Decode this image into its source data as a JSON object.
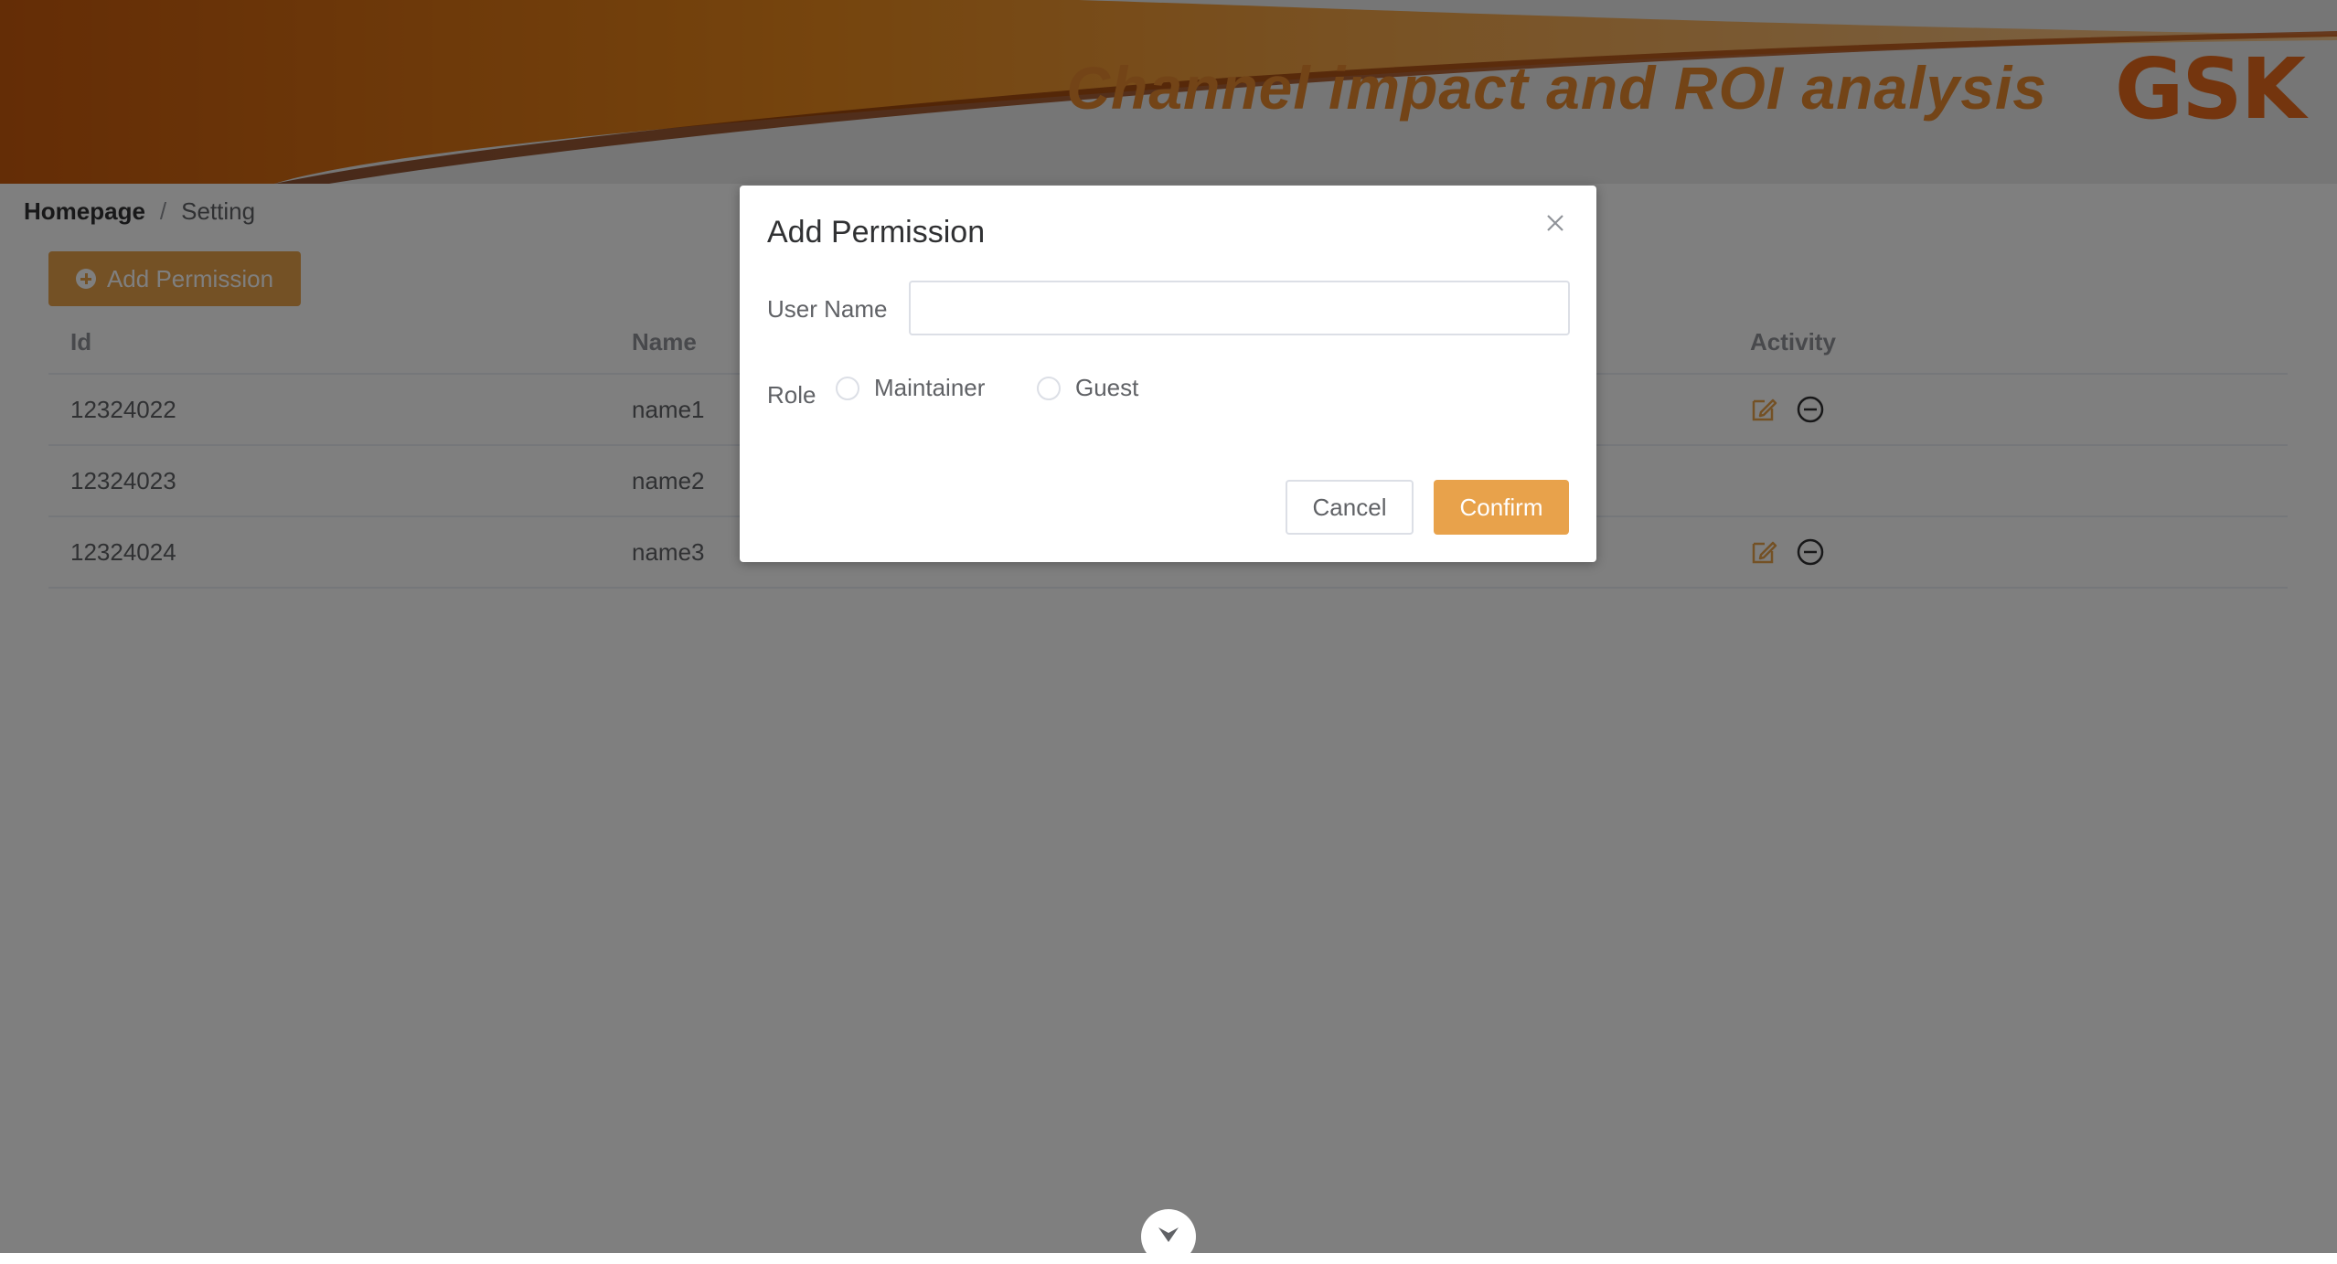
{
  "header": {
    "title": "Channel impact and ROI analysis",
    "logo": "GSK",
    "accent_color": "#e7892f",
    "logo_color": "#e96b1d"
  },
  "breadcrumb": {
    "home": "Homepage",
    "separator": "/",
    "current": "Setting"
  },
  "toolbar": {
    "add_label": "Add Permission",
    "add_icon": "plus-circle-icon",
    "button_color": "#e8a24b"
  },
  "table": {
    "columns": {
      "id": "Id",
      "name": "Name",
      "activity": "Activity"
    },
    "rows": [
      {
        "id": "12324022",
        "name": "name1",
        "actions": [
          "edit-icon",
          "remove-icon"
        ]
      },
      {
        "id": "12324023",
        "name": "name2",
        "actions": []
      },
      {
        "id": "12324024",
        "name": "name3",
        "actions": [
          "edit-icon",
          "remove-icon"
        ]
      }
    ]
  },
  "dialog": {
    "title": "Add Permission",
    "close_icon": "close-icon",
    "user_name_label": "User Name",
    "user_name_value": "",
    "user_name_placeholder": "",
    "role_label": "Role",
    "role_options": [
      "Maintainer",
      "Guest"
    ],
    "role_selected": null,
    "cancel_label": "Cancel",
    "confirm_label": "Confirm"
  },
  "overlay": {
    "toggle_icon": "chevron-down-icon"
  }
}
